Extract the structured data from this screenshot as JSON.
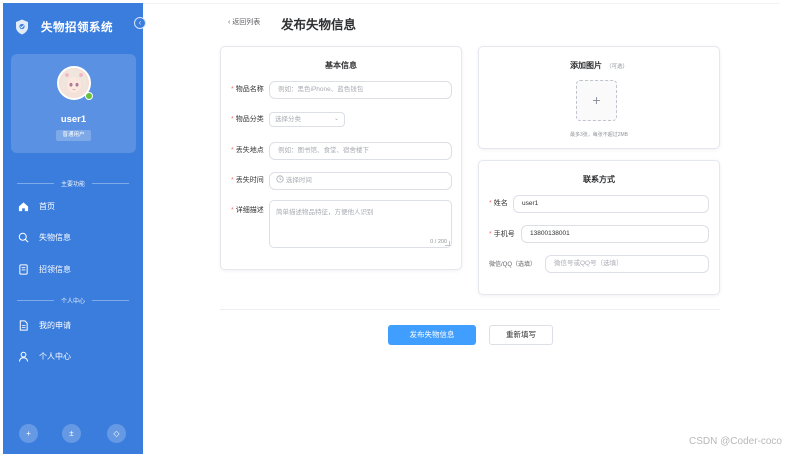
{
  "app": {
    "title": "失物招领系统",
    "collapse_icon": "chevron-left-icon"
  },
  "user": {
    "name": "user1",
    "role": "普通用户",
    "status_color": "#67c23a"
  },
  "sidebar": {
    "background": "#3b7ddd",
    "sections": [
      {
        "label": "主要功能",
        "items": [
          {
            "label": "首页",
            "icon": "home-icon",
            "active": true
          },
          {
            "label": "失物信息",
            "icon": "search-icon",
            "active": false
          },
          {
            "label": "招领信息",
            "icon": "notebook-icon",
            "active": false
          }
        ]
      },
      {
        "label": "个人中心",
        "items": [
          {
            "label": "我的申请",
            "icon": "document-icon",
            "active": false
          },
          {
            "label": "个人中心",
            "icon": "user-icon",
            "active": false
          }
        ]
      }
    ],
    "bottom_buttons": [
      {
        "glyph": "+",
        "icon": "plus-icon"
      },
      {
        "glyph": "±",
        "icon": "plus-minus-icon"
      },
      {
        "glyph": "◇",
        "icon": "diamond-icon"
      }
    ]
  },
  "header": {
    "back_label": "返回列表",
    "title": "发布失物信息"
  },
  "basic_info": {
    "title": "基本信息",
    "fields": {
      "name": {
        "label": "物品名称",
        "placeholder": "例如：黑色iPhone、蓝色钱包"
      },
      "category": {
        "label": "物品分类",
        "placeholder": "选择分类"
      },
      "location": {
        "label": "丢失地点",
        "placeholder": "例如：图书馆、食堂、宿舍楼下"
      },
      "time": {
        "label": "丢失时间",
        "placeholder": "选择时间"
      },
      "description": {
        "label": "详细描述",
        "placeholder": "简单描述物品特征，方便他人识别",
        "counter": "0 / 200"
      }
    }
  },
  "images": {
    "title": "添加图片",
    "optional": "（可选）",
    "hint": "最多3张，每张不超过2MB",
    "plus": "+"
  },
  "contact": {
    "title": "联系方式",
    "fields": {
      "name": {
        "label": "姓名",
        "value": "user1"
      },
      "phone": {
        "label": "手机号",
        "value": "13800138001"
      },
      "wechat": {
        "label": "微信/QQ（选填）",
        "placeholder": "微信号或QQ号（选填）"
      }
    }
  },
  "actions": {
    "submit": "发布失物信息",
    "reset": "重新填写"
  },
  "watermark": "CSDN @Coder-coco",
  "colors": {
    "primary": "#409eff",
    "required": "#f56c6c",
    "sidebar": "#3b7ddd"
  }
}
